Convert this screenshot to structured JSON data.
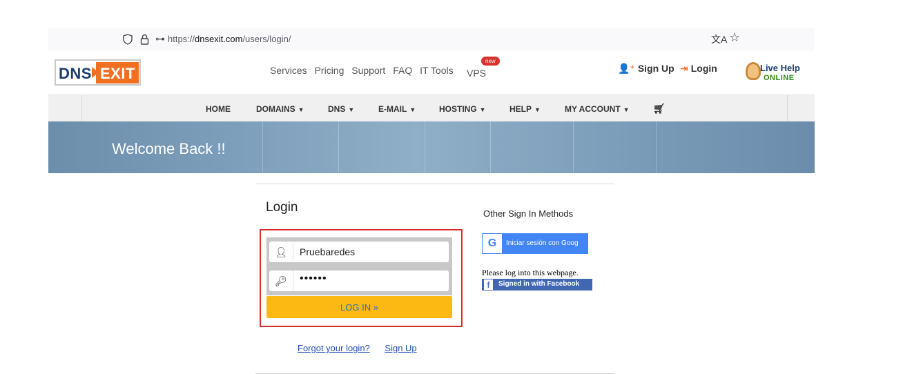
{
  "browser": {
    "url_prefix": "https://",
    "url_domain": "dnsexit.com",
    "url_path": "/users/login/"
  },
  "header": {
    "logo_left": "DNS",
    "logo_right": "EXIT",
    "nav": [
      "Services",
      "Pricing",
      "Support",
      "FAQ",
      "IT Tools"
    ],
    "vps_label": "VPS",
    "new_badge": "new",
    "signup_label": "Sign Up",
    "login_label": "Login",
    "livehelp_title": "Live Help",
    "livehelp_status": "ONLINE"
  },
  "menu": {
    "home": "HOME",
    "domains": "DOMAINS",
    "dns": "DNS",
    "email": "E-MAIL",
    "hosting": "HOSTING",
    "help": "HELP",
    "account": "MY ACCOUNT"
  },
  "hero": {
    "title": "Welcome Back !!"
  },
  "login": {
    "title": "Login",
    "username_value": "Pruebaredes",
    "password_mask": "••••••",
    "submit_label": "LOG IN »",
    "forgot_label": "Forgot your login?",
    "signup_link": "Sign Up"
  },
  "other": {
    "title": "Other Sign In Methods",
    "google_label": "Iniciar sesión con Goog",
    "fb_prompt": "Please log into this webpage.",
    "fb_label": "Signed in with Facebook"
  },
  "colors": {
    "brand_orange": "#f07021",
    "brand_navy": "#1a3d6d",
    "login_button": "#fdb913",
    "highlight_border": "#d9302b"
  }
}
